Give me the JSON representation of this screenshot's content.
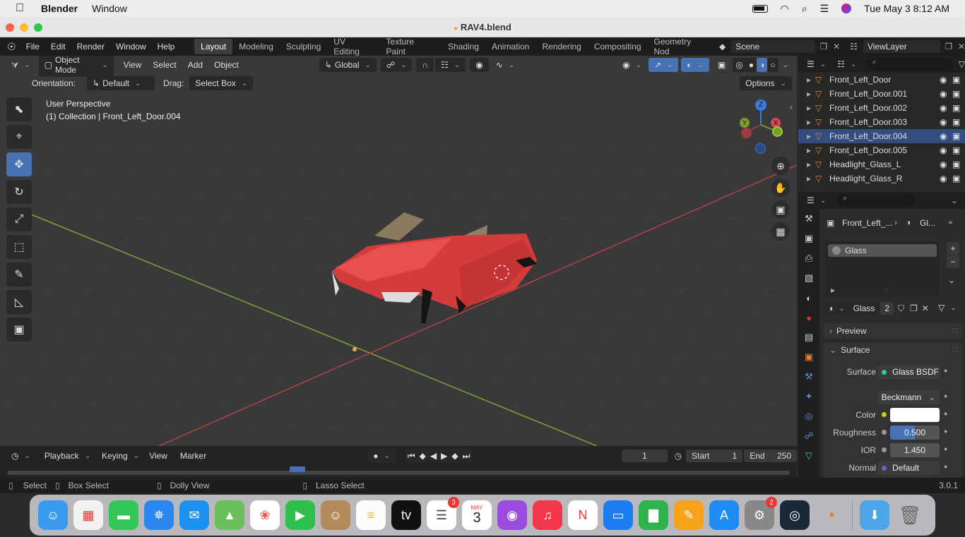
{
  "menubar": {
    "app_name": "Blender",
    "menu_window": "Window",
    "date_time": "Tue May 3  8:12 AM"
  },
  "window": {
    "title": "RAV4.blend"
  },
  "topbar": {
    "menus": [
      "File",
      "Edit",
      "Render",
      "Window",
      "Help"
    ],
    "workspaces": [
      "Layout",
      "Modeling",
      "Sculpting",
      "UV Editing",
      "Texture Paint",
      "Shading",
      "Animation",
      "Rendering",
      "Compositing",
      "Geometry Nod"
    ],
    "active_workspace": "Layout",
    "scene": "Scene",
    "view_layer": "ViewLayer"
  },
  "viewport": {
    "mode": "Object Mode",
    "menus": [
      "View",
      "Select",
      "Add",
      "Object"
    ],
    "transform_orientation": "Global",
    "orientation_label": "Orientation:",
    "orientation_value": "Default",
    "drag_label": "Drag:",
    "drag_value": "Select Box",
    "options": "Options",
    "perspective": "User Perspective",
    "collection_info": "(1) Collection | Front_Left_Door.004",
    "gizmo": {
      "z": "Z",
      "y": "Y",
      "x": "X"
    }
  },
  "outliner": {
    "items": [
      {
        "name": "Front_Left_Door",
        "selected": false
      },
      {
        "name": "Front_Left_Door.001",
        "selected": false
      },
      {
        "name": "Front_Left_Door.002",
        "selected": false
      },
      {
        "name": "Front_Left_Door.003",
        "selected": false
      },
      {
        "name": "Front_Left_Door.004",
        "selected": true
      },
      {
        "name": "Front_Left_Door.005",
        "selected": false
      },
      {
        "name": "Headlight_Glass_L",
        "selected": false
      },
      {
        "name": "Headlight_Glass_R",
        "selected": false
      }
    ]
  },
  "properties": {
    "breadcrumb_object": "Front_Left_...",
    "breadcrumb_material": "Gl...",
    "material_slot": "Glass",
    "material_name": "Glass",
    "material_users": "2",
    "panel_preview": "Preview",
    "panel_surface": "Surface",
    "surface_label": "Surface",
    "surface_value": "Glass BSDF",
    "distribution": "Beckmann",
    "color_label": "Color",
    "roughness_label": "Roughness",
    "roughness_value": "0.500",
    "ior_label": "IOR",
    "ior_value": "1.450",
    "normal_label": "Normal",
    "normal_value": "Default"
  },
  "timeline": {
    "menus": [
      "Playback",
      "Keying",
      "View",
      "Marker"
    ],
    "current_frame": "1",
    "start_label": "Start",
    "start_value": "1",
    "end_label": "End",
    "end_value": "250"
  },
  "statusbar": {
    "select": "Select",
    "box_select": "Box Select",
    "dolly_view": "Dolly View",
    "lasso_select": "Lasso Select",
    "version": "3.0.1"
  },
  "dock": {
    "calendar_month": "MAY",
    "calendar_day": "3",
    "reminders_badge": "3",
    "settings_badge": "2"
  }
}
